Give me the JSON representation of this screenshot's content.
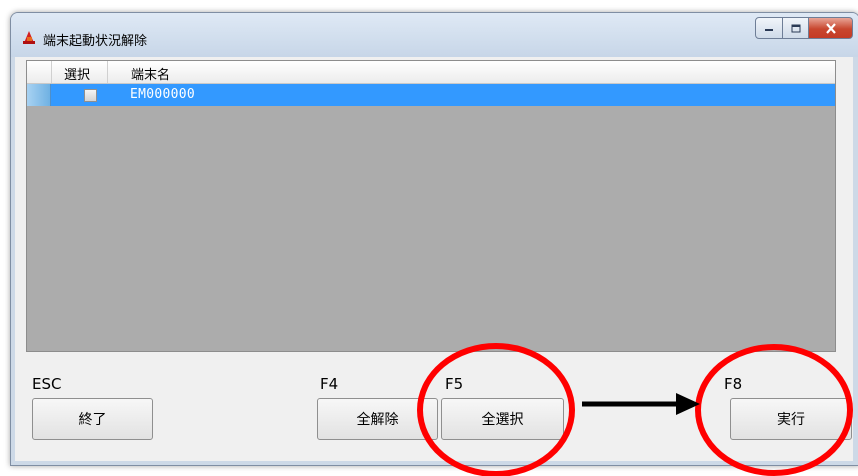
{
  "window": {
    "title": "端末起動状況解除",
    "controls": {
      "minimize_icon": "minimize-icon",
      "maximize_icon": "maximize-icon",
      "close_icon": "close-icon"
    }
  },
  "grid": {
    "columns": [
      "選択",
      "端末名"
    ],
    "rows": [
      {
        "selected": false,
        "terminal_name": "EM000000"
      }
    ]
  },
  "function_keys": [
    {
      "key": "ESC",
      "label": "終了"
    },
    {
      "key": "F4",
      "label": "全解除"
    },
    {
      "key": "F5",
      "label": "全選択"
    },
    {
      "key": "F8",
      "label": "実行"
    }
  ],
  "colors": {
    "selection": "#3399ff",
    "grid_background": "#acacac",
    "annotation": "#ff0000",
    "arrow": "#000000"
  }
}
